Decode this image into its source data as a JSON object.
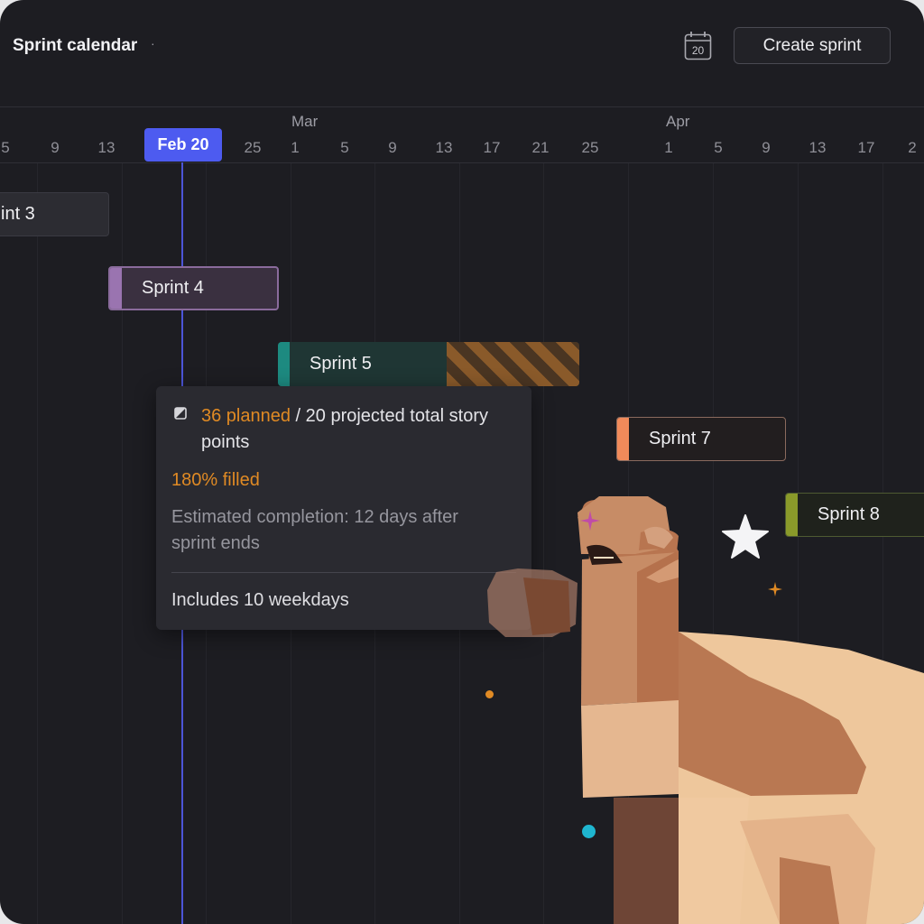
{
  "header": {
    "title": "Sprint calendar",
    "title_suffix": "·",
    "calendar_icon_day": "20",
    "create_button": "Create sprint"
  },
  "timeline": {
    "months": [
      "Mar",
      "Apr"
    ],
    "ticks": [
      "5",
      "9",
      "13",
      "25",
      "1",
      "5",
      "9",
      "13",
      "17",
      "21",
      "25",
      "1",
      "5",
      "9",
      "13",
      "17",
      "2"
    ],
    "today_label": "Feb 20"
  },
  "sprints": {
    "sprint3": "int 3",
    "sprint4": "Sprint 4",
    "sprint5": "Sprint 5",
    "sprint7": "Sprint 7",
    "sprint8": "Sprint 8"
  },
  "tooltip": {
    "planned": "36 planned",
    "projected": " / 20 projected total story points",
    "filled": "180% filled",
    "estimate": "Estimated completion: 12 days after sprint ends",
    "weekdays": "Includes 10 weekdays"
  },
  "colors": {
    "background": "#1d1d22",
    "today": "#4d5bf0",
    "sprint4_accent": "#9a74b0",
    "sprint5_accent": "#1d8a80",
    "sprint7_accent": "#f08a5a",
    "sprint8_accent": "#8a9a2a",
    "overfill": "#e08a24"
  }
}
